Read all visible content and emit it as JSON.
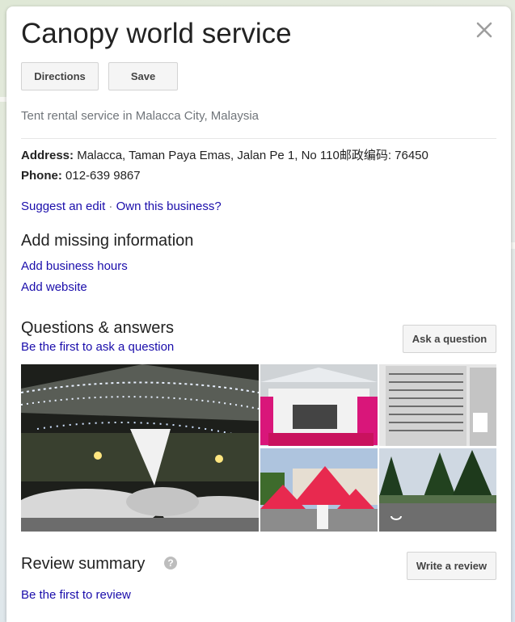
{
  "place": {
    "name": "Canopy world service",
    "category": "Tent rental service in Malacca City, Malaysia"
  },
  "actions": {
    "directions_label": "Directions",
    "save_label": "Save"
  },
  "details": {
    "address_label": "Address:",
    "address_value": "Malacca, Taman Paya Emas, Jalan Pe 1, No 110邮政编码: 76450",
    "phone_label": "Phone:",
    "phone_value": "012-639 9867"
  },
  "edit_links": {
    "suggest_edit": "Suggest an edit",
    "separator": "·",
    "own_business": "Own this business?"
  },
  "missing_info": {
    "title": "Add missing information",
    "add_hours": "Add business hours",
    "add_website": "Add website"
  },
  "qa": {
    "title": "Questions & answers",
    "first_ask": "Be the first to ask a question",
    "ask_button": "Ask a question"
  },
  "photos": [
    {
      "icon": "tent-event-night-photo"
    },
    {
      "icon": "pink-canopy-photo"
    },
    {
      "icon": "air-cooler-photo"
    },
    {
      "icon": "red-tents-photo"
    },
    {
      "icon": "street-view-photo"
    }
  ],
  "review": {
    "title": "Review summary",
    "help_icon": "?",
    "write_button": "Write a review",
    "first_review": "Be the first to review"
  },
  "colors": {
    "link": "#1a0dab",
    "title": "#222222",
    "muted": "#70757a",
    "button_bg": "#f5f5f5"
  }
}
